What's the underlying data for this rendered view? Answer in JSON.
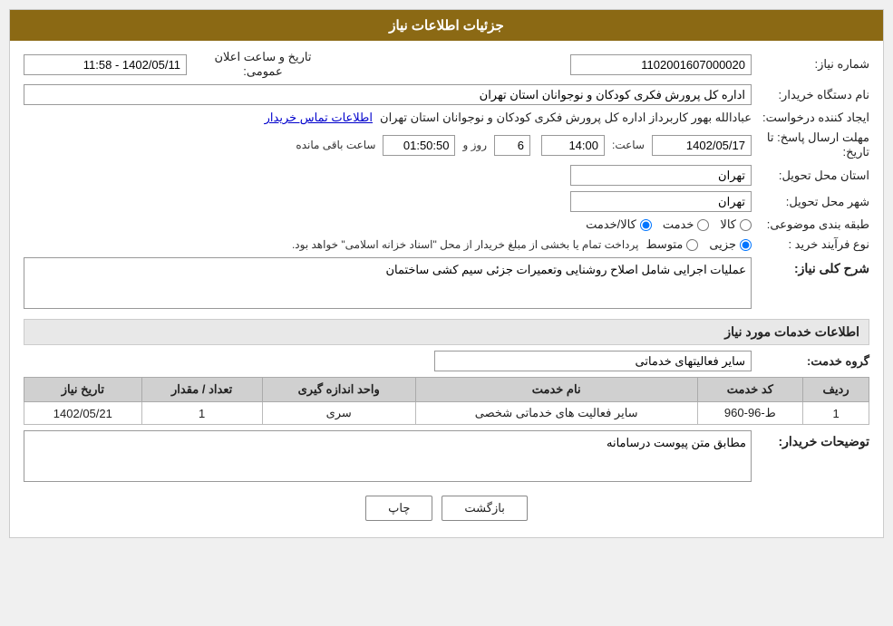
{
  "header": {
    "title": "جزئیات اطلاعات نیاز"
  },
  "fields": {
    "need_number_label": "شماره نیاز:",
    "need_number_value": "1102001607000020",
    "announce_datetime_label": "تاریخ و ساعت اعلان عمومی:",
    "announce_datetime_value": "1402/05/11 - 11:58",
    "org_name_label": "نام دستگاه خریدار:",
    "org_name_value": "اداره کل پرورش فکری کودکان و نوجوانان استان تهران",
    "requester_label": "ایجاد کننده درخواست:",
    "requester_value": "عبادالله بهور کاربرداز اداره کل پرورش فکری کودکان و نوجوانان استان تهران",
    "contact_link": "اطلاعات تماس خریدار",
    "deadline_label": "مهلت ارسال پاسخ: تا تاریخ:",
    "deadline_date": "1402/05/17",
    "deadline_time_label": "ساعت:",
    "deadline_time": "14:00",
    "deadline_days_label": "روز و",
    "deadline_days": "6",
    "deadline_remaining_label": "ساعت باقی مانده",
    "deadline_remaining": "01:50:50",
    "province_label": "استان محل تحویل:",
    "province_value": "تهران",
    "city_label": "شهر محل تحویل:",
    "city_value": "تهران",
    "category_label": "طبقه بندی موضوعی:",
    "category_kala": "کالا",
    "category_khadamat": "خدمت",
    "category_kala_khadamat": "کالا/خدمت",
    "process_label": "نوع فرآیند خرید :",
    "process_jozi": "جزیی",
    "process_motavaset": "متوسط",
    "process_note": "پرداخت تمام یا بخشی از مبلغ خریدار از محل \"اسناد خزانه اسلامی\" خواهد بود.",
    "description_section_label": "شرح کلی نیاز:",
    "description_value": "عملیات اجرایی شامل اصلاح روشنایی وتعمیرات جزئی سیم کشی ساختمان",
    "services_section_label": "اطلاعات خدمات مورد نیاز",
    "service_group_label": "گروه خدمت:",
    "service_group_value": "سایر فعالیتهای خدماتی",
    "table_headers": {
      "radif": "ردیف",
      "code": "کد خدمت",
      "name": "نام خدمت",
      "unit": "واحد اندازه گیری",
      "quantity": "تعداد / مقدار",
      "date": "تاریخ نیاز"
    },
    "table_rows": [
      {
        "radif": "1",
        "code": "ط-96-960",
        "name": "سایر فعالیت های خدماتی شخصی",
        "unit": "سری",
        "quantity": "1",
        "date": "1402/05/21"
      }
    ],
    "buyer_notes_label": "توضیحات خریدار:",
    "buyer_notes_value": "مطابق متن پیوست درسامانه"
  },
  "buttons": {
    "print_label": "چاپ",
    "back_label": "بازگشت"
  }
}
